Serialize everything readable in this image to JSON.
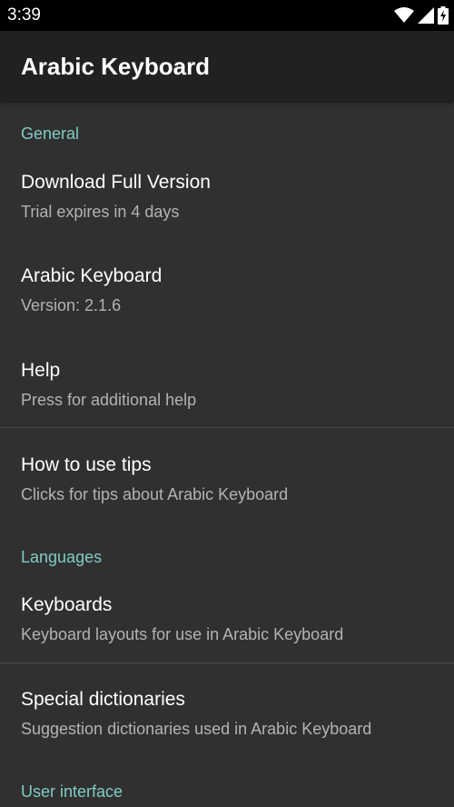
{
  "status_bar": {
    "time": "3:39",
    "icons": [
      "wifi-icon",
      "signal-icon",
      "battery-icon"
    ]
  },
  "app_bar": {
    "title": "Arabic Keyboard"
  },
  "sections": {
    "general": "General",
    "languages": "Languages",
    "user_interface": "User interface"
  },
  "items": {
    "download": {
      "title": "Download Full Version",
      "summary": "Trial expires in 4 days"
    },
    "about": {
      "title": "Arabic Keyboard",
      "summary": "Version: 2.1.6"
    },
    "help": {
      "title": "Help",
      "summary": "Press for additional help"
    },
    "tips": {
      "title": "How to use tips",
      "summary": "Clicks for tips about Arabic Keyboard"
    },
    "keyboards": {
      "title": "Keyboards",
      "summary": "Keyboard layouts for use in Arabic Keyboard"
    },
    "dictionaries": {
      "title": "Special dictionaries",
      "summary": "Suggestion dictionaries used in Arabic Keyboard"
    }
  },
  "colors": {
    "accent": "#80cbc4",
    "background": "#303030",
    "appbar": "#212121"
  }
}
